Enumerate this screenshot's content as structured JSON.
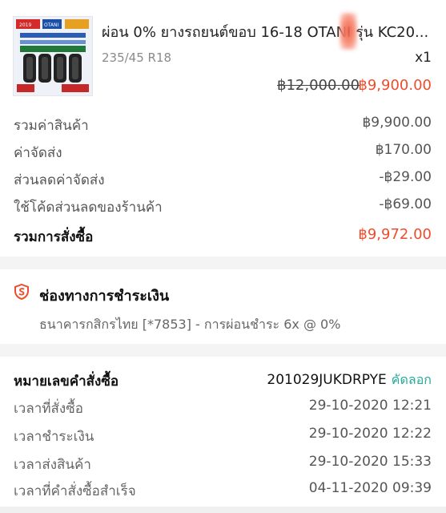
{
  "product": {
    "title": "ผ่อน 0% ยางรถยนต์ขอบ 16-18  OTANI รุ่น KC20...",
    "variant": "235/45 R18",
    "quantity": "x1",
    "original_price": "฿12,000.00",
    "price": "฿9,900.00",
    "thumb_brand": "OTANI",
    "thumb_year": "2019"
  },
  "summary": [
    {
      "label": "รวมค่าสินค้า",
      "value": "฿9,900.00"
    },
    {
      "label": "ค่าจัดส่ง",
      "value": "฿170.00"
    },
    {
      "label": "ส่วนลดค่าจัดส่ง",
      "value": "-฿29.00"
    },
    {
      "label": "ใช้โค้ดส่วนลดของร้านค้า",
      "value": "-฿69.00"
    },
    {
      "label": "รวมการสั่งซื้อ",
      "value": "฿9,972.00"
    }
  ],
  "payment": {
    "title": "ช่องทางการชำระเงิน",
    "detail": "ธนาคารกสิกรไทย [*7853] - การผ่อนชำระ 6x @ 0%",
    "icon": "shield-icon"
  },
  "order": {
    "id_label": "หมายเลขคำสั่งซื้อ",
    "id_value": "201029JUKDRPYE",
    "copy_label": "คัดลอก",
    "rows": [
      {
        "label": "เวลาที่สั่งซื้อ",
        "value": "29-10-2020 12:21"
      },
      {
        "label": "เวลาชำระเงิน",
        "value": "29-10-2020 12:22"
      },
      {
        "label": "เวลาส่งสินค้า",
        "value": "29-10-2020 15:33"
      },
      {
        "label": "เวลาที่คำสั่งซื้อสำเร็จ",
        "value": "04-11-2020 09:39"
      }
    ]
  },
  "colors": {
    "accent": "#ee4d2d",
    "copy": "#26aa99"
  }
}
